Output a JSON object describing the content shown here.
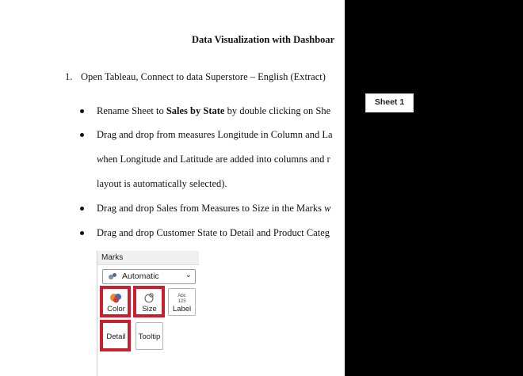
{
  "document": {
    "title": "Data Visualization with Dashboar",
    "step": {
      "number": "1.",
      "text": "Open Tableau, Connect to data Superstore – English (Extract)"
    },
    "bullets": [
      {
        "prefix": "Rename Sheet to ",
        "bold": "Sales by State",
        "suffix": " by double clicking on She"
      },
      {
        "line1": "Drag and drop from measures Longitude in Column and La",
        "line2_italic": "w",
        "line2_rest": "hen Longitude and Latitude are added into columns and r",
        "line3": "layout is automatically selected)."
      },
      {
        "prefix": "Drag and drop Sales from Measures to Size in the Marks ",
        "italic": "w"
      },
      {
        "text": "Drag and drop Customer State to Detail and Product Categ"
      }
    ]
  },
  "marks_panel": {
    "title": "Marks",
    "mark_type": "Automatic",
    "cards": [
      {
        "label": "Color",
        "icon": "color-icon",
        "highlighted": true
      },
      {
        "label": "Size",
        "icon": "size-icon",
        "highlighted": true
      },
      {
        "label": "Label",
        "icon": "label-icon",
        "icon_text": "Abc\n123",
        "highlighted": false
      },
      {
        "label": "Detail",
        "icon": "detail-icon",
        "highlighted": true
      },
      {
        "label": "Tooltip",
        "icon": "tooltip-icon",
        "highlighted": false
      }
    ],
    "highlight_color": "#c8202f"
  },
  "sheet_tab": {
    "label": "Sheet 1"
  }
}
